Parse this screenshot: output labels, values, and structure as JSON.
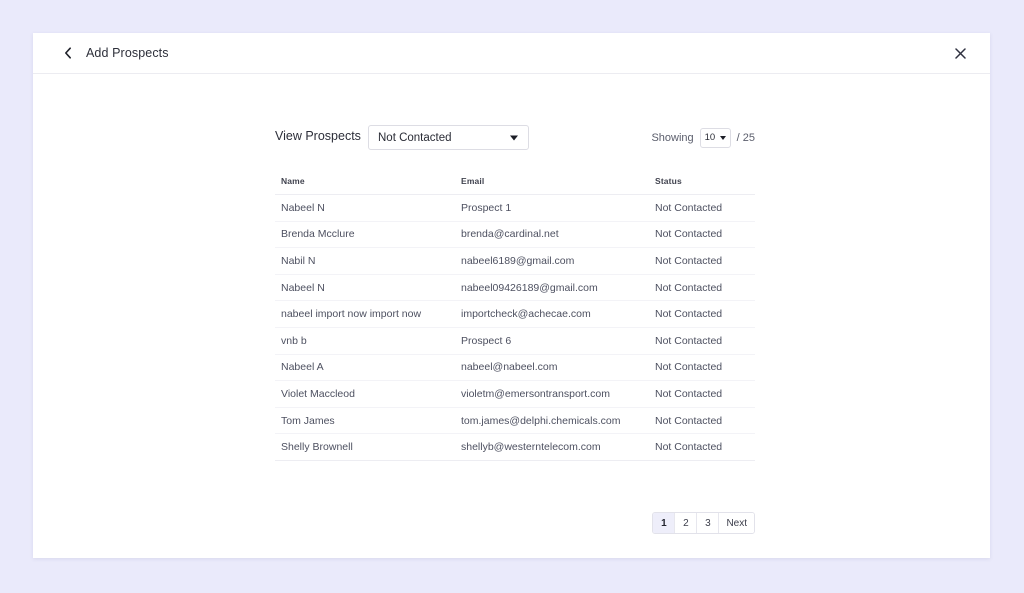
{
  "page": {
    "background_color": "#eaeafb"
  },
  "modal": {
    "title": "Add Prospects",
    "back_icon": "chevron-left-icon",
    "close_icon": "close-icon"
  },
  "toolbar": {
    "view_label": "View Prospects",
    "filter": {
      "selected": "Not Contacted",
      "options": [
        "Not Contacted"
      ]
    },
    "showing_label": "Showing",
    "page_size": {
      "selected": "10",
      "options": [
        "10"
      ]
    },
    "total_label": "/ 25"
  },
  "table": {
    "columns": [
      "Name",
      "Email",
      "Status"
    ],
    "rows": [
      {
        "name": "Nabeel N",
        "email": "Prospect 1",
        "status": "Not Contacted"
      },
      {
        "name": "Brenda Mcclure",
        "email": "brenda@cardinal.net",
        "status": "Not Contacted"
      },
      {
        "name": "Nabil N",
        "email": "nabeel6189@gmail.com",
        "status": "Not Contacted"
      },
      {
        "name": "Nabeel N",
        "email": "nabeel09426189@gmail.com",
        "status": "Not Contacted"
      },
      {
        "name": "nabeel import now import now",
        "email": "importcheck@achecae.com",
        "status": "Not Contacted"
      },
      {
        "name": "vnb b",
        "email": "Prospect 6",
        "status": "Not Contacted"
      },
      {
        "name": "Nabeel A",
        "email": "nabeel@nabeel.com",
        "status": "Not Contacted"
      },
      {
        "name": "Violet Maccleod",
        "email": "violetm@emersontransport.com",
        "status": "Not Contacted"
      },
      {
        "name": "Tom James",
        "email": "tom.james@delphi.chemicals.com",
        "status": "Not Contacted"
      },
      {
        "name": "Shelly Brownell",
        "email": "shellyb@westerntelecom.com",
        "status": "Not Contacted"
      }
    ]
  },
  "pagination": {
    "pages": [
      "1",
      "2",
      "3"
    ],
    "active_page": "1",
    "next_label": "Next",
    "active_background": "#eeeefa"
  }
}
